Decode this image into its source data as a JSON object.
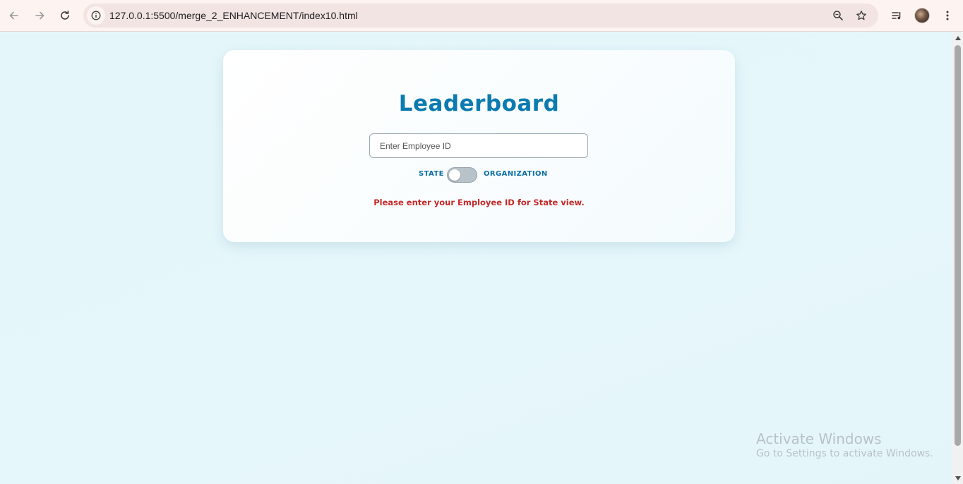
{
  "browser": {
    "url": "127.0.0.1:5500/merge_2_ENHANCEMENT/index10.html",
    "icons": {
      "back": "arrow-left-icon",
      "forward": "arrow-right-icon",
      "reload": "reload-icon",
      "site_info": "info-icon",
      "zoom": "zoom-icon",
      "bookmark": "star-icon",
      "media": "media-controls-icon",
      "profile": "avatar",
      "menu": "kebab-menu-icon"
    }
  },
  "leaderboard": {
    "title": "Leaderboard",
    "employee_input": {
      "placeholder": "Enter Employee ID",
      "value": ""
    },
    "toggle": {
      "left_label": "STATE",
      "right_label": "ORGANIZATION",
      "selected": "STATE"
    },
    "message": "Please enter your Employee ID for State view."
  },
  "watermark": {
    "title": "Activate Windows",
    "subtitle": "Go to Settings to activate Windows."
  },
  "colors": {
    "accent": "#0b7bb0",
    "error": "#c62828",
    "page_bg": "#e6f6fb",
    "chrome_bg": "#fdf3f1"
  }
}
